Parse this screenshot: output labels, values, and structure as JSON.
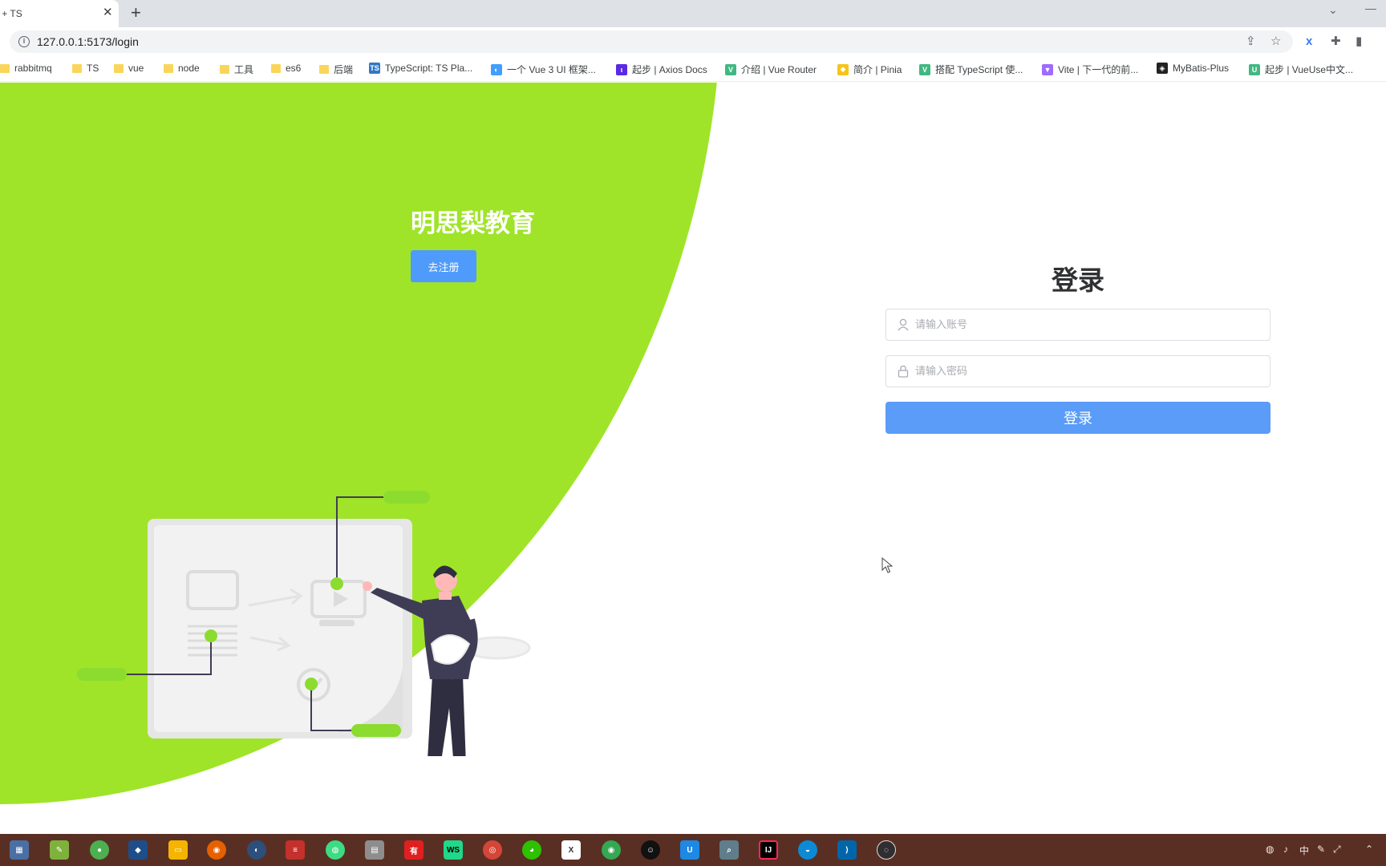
{
  "browser": {
    "tab_title": "Vue + TS",
    "tab_close": "✕",
    "new_tab": "+",
    "url": "127.0.0.1:5173/login"
  },
  "bookmarks": [
    {
      "label": "rabbitmq",
      "type": "folder"
    },
    {
      "label": "TS",
      "type": "folder"
    },
    {
      "label": "vue",
      "type": "folder"
    },
    {
      "label": "node",
      "type": "folder"
    },
    {
      "label": "工具",
      "type": "folder"
    },
    {
      "label": "es6",
      "type": "folder"
    },
    {
      "label": "后端",
      "type": "folder"
    },
    {
      "label": "TypeScript: TS Pla...",
      "type": "site",
      "icon": "ts-icon"
    },
    {
      "label": "一个 Vue 3 UI 框架...",
      "type": "site",
      "icon": "element-plus-icon"
    },
    {
      "label": "起步 | Axios Docs",
      "type": "site",
      "icon": "axios-icon"
    },
    {
      "label": "介绍 | Vue Router",
      "type": "site",
      "icon": "vue-icon"
    },
    {
      "label": "简介 | Pinia",
      "type": "site",
      "icon": "pinia-icon"
    },
    {
      "label": "搭配 TypeScript 使...",
      "type": "site",
      "icon": "vue-icon"
    },
    {
      "label": "Vite | 下一代的前...",
      "type": "site",
      "icon": "vite-icon"
    },
    {
      "label": "MyBatis-Plus",
      "type": "site",
      "icon": "mybatis-icon"
    },
    {
      "label": "起步 | VueUse中文...",
      "type": "site",
      "icon": "vueuse-icon"
    }
  ],
  "hero": {
    "title": "明思梨教育",
    "register_button": "去注册"
  },
  "login": {
    "title": "登录",
    "account_placeholder": "请输入账号",
    "password_placeholder": "请输入密码",
    "submit": "登录"
  },
  "colors": {
    "hero_green": "#9fe428",
    "primary_blue": "#5a9cf8",
    "taskbar": "#5a2f23"
  },
  "taskbar": {
    "tray_ime": "中"
  }
}
